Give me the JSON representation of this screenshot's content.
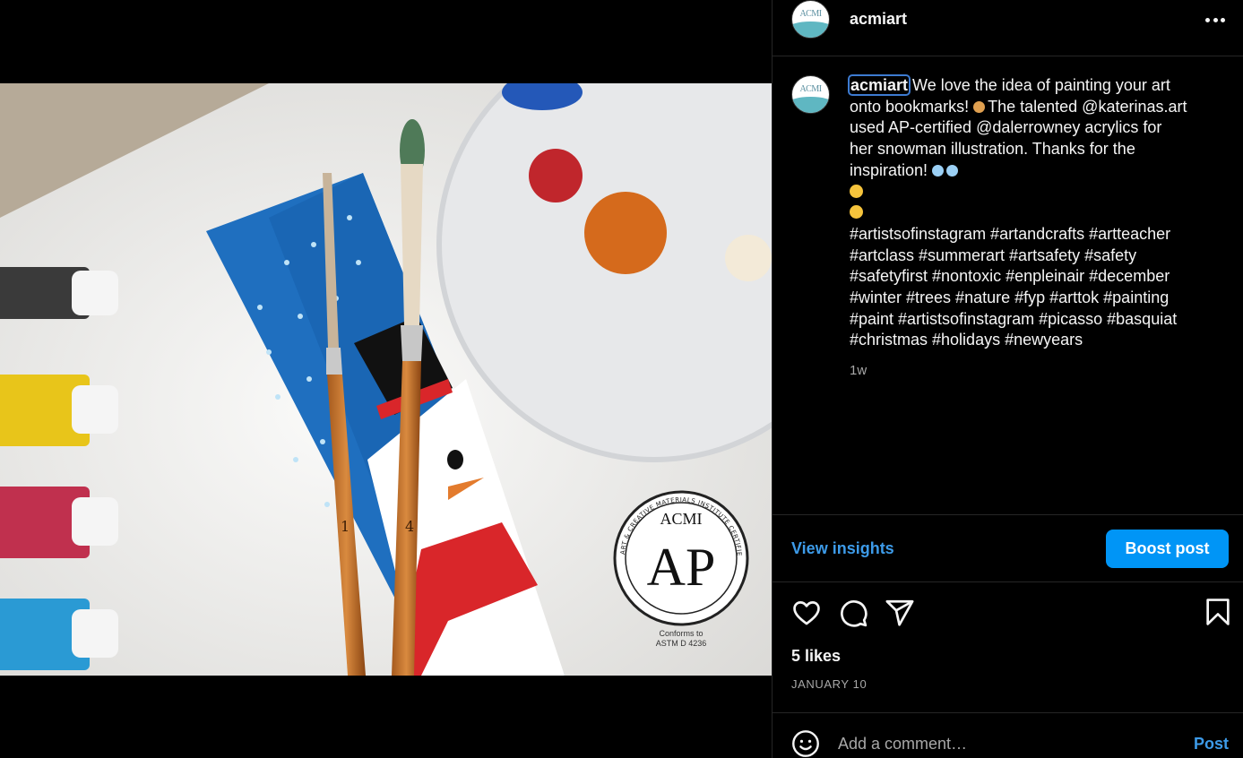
{
  "post": {
    "username": "acmiart",
    "avatar_text": "ACMI",
    "caption_lines": [
      "We love the idea of painting your art",
      "onto bookmarks!",
      "The talented @katerinas.art",
      "used AP-certified @dalerrowney acrylics for",
      "her snowman illustration. Thanks for the",
      "inspiration!"
    ],
    "hashtag_lines": [
      "#artistsofinstagram #artandcrafts #artteacher",
      "#artclass #summerart #artsafety #safety",
      "#safetyfirst #nontoxic #enpleinair #december",
      "#winter #trees #nature #fyp #arttok #painting",
      "#paint #artistsofinstagram #picasso #basquiat",
      "#christmas #holidays #newyears"
    ],
    "time_ago": "1w",
    "likes": "5 likes",
    "date": "JANUARY 10"
  },
  "insights": {
    "view_label": "View insights",
    "boost_label": "Boost post"
  },
  "comment": {
    "placeholder": "Add a comment…",
    "post_label": "Post"
  },
  "image": {
    "seal_top": "ACMI",
    "seal_mid": "AP",
    "seal_ring": "ART & CREATIVE MATERIALS INSTITUTE CERTIFIED",
    "seal_note1": "Conforms to",
    "seal_note2": "ASTM D 4236",
    "brush_small_number": "1",
    "brush_large_number": "4"
  },
  "colors": {
    "accent": "#0095f6",
    "link": "#3d9be9",
    "background": "#000000",
    "divider": "#262626",
    "secondary_text": "#a8a8a8"
  },
  "icons": [
    "more-icon",
    "heart-icon",
    "comment-icon",
    "share-icon",
    "bookmark-icon",
    "emoji-icon"
  ]
}
